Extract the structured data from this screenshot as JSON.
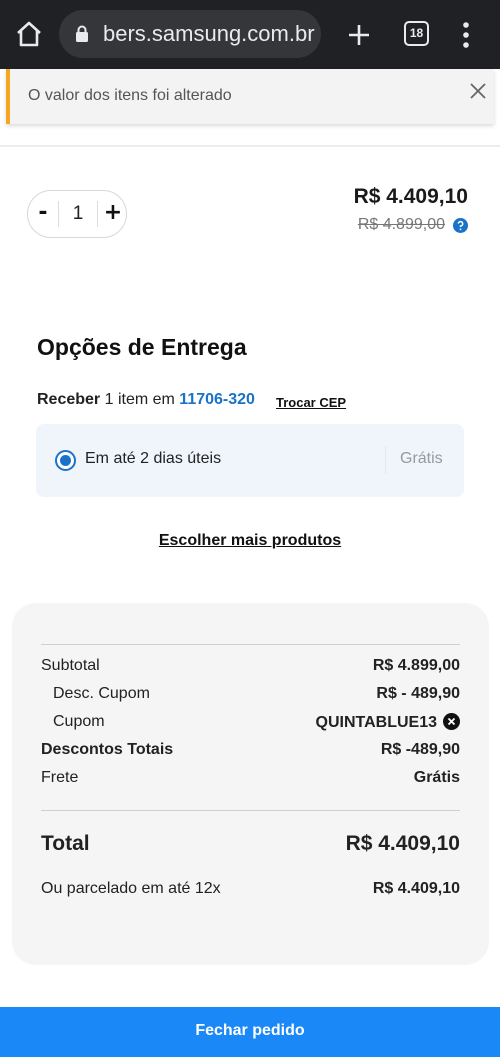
{
  "browser": {
    "url": "bers.samsung.com.br",
    "tab_count": "18"
  },
  "toast": {
    "message": "O valor dos itens foi alterado"
  },
  "product": {
    "quantity": "1",
    "minus_label": "-",
    "plus_label": "+",
    "price_now": "R$ 4.409,10",
    "price_old": "R$ 4.899,00"
  },
  "delivery": {
    "title": "Opções de Entrega",
    "receive_prefix": "Receber",
    "receive_middle": " 1 item em ",
    "cep": "11706-320",
    "change_cep": "Trocar CEP",
    "option_label": "Em até 2 dias úteis",
    "option_price": "Grátis"
  },
  "choose_more": "Escolher mais produtos",
  "summary": {
    "subtotal_label": "Subtotal",
    "subtotal_value": "R$ 4.899,00",
    "coupon_discount_label": "Desc. Cupom",
    "coupon_discount_value": "R$ - 489,90",
    "coupon_label": "Cupom",
    "coupon_code": "QUINTABLUE13",
    "total_discounts_label": "Descontos Totais",
    "total_discounts_value": "R$ -489,90",
    "shipping_label": "Frete",
    "shipping_value": "Grátis",
    "total_label": "Total",
    "total_value": "R$ 4.409,10",
    "installments_label": "Ou parcelado em até 12x",
    "installments_value": "R$ 4.409,10"
  },
  "cta": {
    "label": "Fechar pedido"
  },
  "colors": {
    "accent": "#1b88f7",
    "link": "#1a73c9",
    "warning": "#f5a623"
  }
}
